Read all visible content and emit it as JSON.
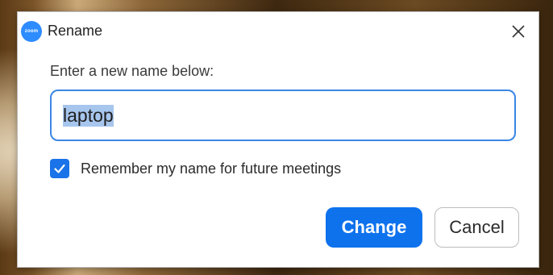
{
  "dialog": {
    "app_logo_text": "zoom",
    "title": "Rename",
    "close_icon": "close-icon",
    "prompt": "Enter a new name below:",
    "name_input": {
      "value": "laptop"
    },
    "remember": {
      "label": "Remember my name for future meetings",
      "checked": true
    },
    "buttons": {
      "change_label": "Change",
      "cancel_label": "Cancel"
    }
  },
  "colors": {
    "accent": "#0e72ed",
    "input_border": "#3b87e4",
    "checkbox": "#1a73e8",
    "logo": "#2d8cff"
  }
}
